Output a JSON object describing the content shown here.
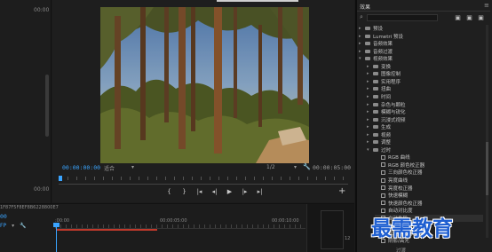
{
  "source": {
    "timecode": "00:00",
    "bottom_timecode": "00:00"
  },
  "program_monitor": {
    "current_timecode": "00:00:00:00",
    "fit_label": "适合",
    "resolution_label": "1/2",
    "duration_timecode": "00:00:05:00",
    "transport": [
      "step-back",
      "mark-in",
      "go-to-in",
      "step-back-frame",
      "play",
      "step-forward-frame",
      "go-to-out"
    ],
    "add_button": "+",
    "playhead_position": 0
  },
  "timeline": {
    "sequence_id": "1F87F5F8EF8B6228800E7",
    "timecode": "00",
    "tools": [
      "FP",
      "▾",
      "🔧"
    ],
    "ruler_labels": [
      ":00:00",
      "00:00:05:00",
      "00:00:10:00"
    ],
    "meter_label": "12"
  },
  "effects_panel": {
    "title": "效果",
    "search_placeholder": "",
    "tree": [
      {
        "label": "预设",
        "level": 0,
        "type": "folder"
      },
      {
        "label": "Lumetri 预设",
        "level": 0,
        "type": "folder"
      },
      {
        "label": "音频效果",
        "level": 0,
        "type": "folder"
      },
      {
        "label": "音频过渡",
        "level": 0,
        "type": "folder"
      },
      {
        "label": "视频效果",
        "level": 0,
        "type": "folder",
        "expanded": true
      },
      {
        "label": "变换",
        "level": 1,
        "type": "folder"
      },
      {
        "label": "图像控制",
        "level": 1,
        "type": "folder"
      },
      {
        "label": "实用程序",
        "level": 1,
        "type": "folder"
      },
      {
        "label": "扭曲",
        "level": 1,
        "type": "folder"
      },
      {
        "label": "时间",
        "level": 1,
        "type": "folder"
      },
      {
        "label": "杂色与颗粒",
        "level": 1,
        "type": "folder"
      },
      {
        "label": "模糊与锐化",
        "level": 1,
        "type": "folder"
      },
      {
        "label": "沉浸式视频",
        "level": 1,
        "type": "folder"
      },
      {
        "label": "生成",
        "level": 1,
        "type": "folder"
      },
      {
        "label": "视频",
        "level": 1,
        "type": "folder"
      },
      {
        "label": "调整",
        "level": 1,
        "type": "folder"
      },
      {
        "label": "过时",
        "level": 1,
        "type": "folder",
        "expanded": true
      },
      {
        "label": "RGB 曲线",
        "level": 2,
        "type": "effect"
      },
      {
        "label": "RGB 颜色校正器",
        "level": 2,
        "type": "effect"
      },
      {
        "label": "三向颜色校正器",
        "level": 2,
        "type": "effect"
      },
      {
        "label": "亮度曲线",
        "level": 2,
        "type": "effect"
      },
      {
        "label": "亮度校正器",
        "level": 2,
        "type": "effect"
      },
      {
        "label": "快速模糊",
        "level": 2,
        "type": "effect"
      },
      {
        "label": "快速颜色校正器",
        "level": 2,
        "type": "effect"
      },
      {
        "label": "自动对比度",
        "level": 2,
        "type": "effect"
      },
      {
        "label": "自动色阶",
        "level": 2,
        "type": "effect",
        "highlight": true
      },
      {
        "label": "自动颜色",
        "level": 2,
        "type": "effect"
      },
      {
        "label": "视频限幅器（旧版）",
        "level": 2,
        "type": "effect"
      },
      {
        "label": "阴影/高光",
        "level": 2,
        "type": "effect"
      }
    ],
    "bottom_label": "过渡"
  },
  "watermark": "最需教育",
  "colors": {
    "accent": "#3aa4ff",
    "work_area": "#c0392b",
    "watermark": "#1f5fd1"
  }
}
